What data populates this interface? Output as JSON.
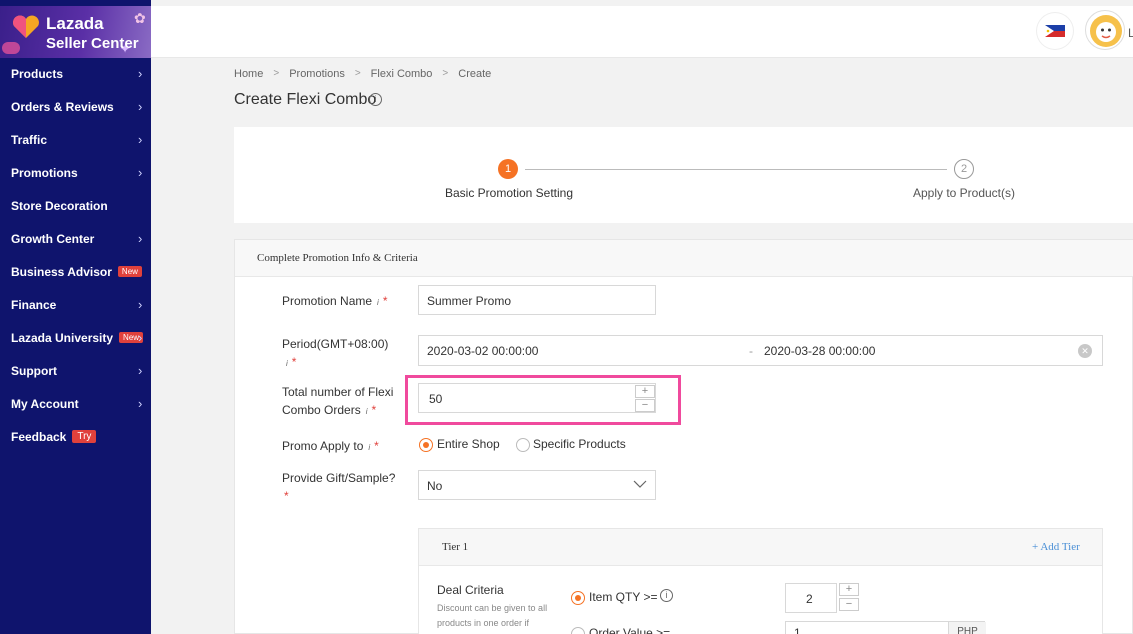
{
  "brand": {
    "name": "Lazada",
    "sub": "Seller Center"
  },
  "sidebar": {
    "items": [
      {
        "label": "Products",
        "chevron": true
      },
      {
        "label": "Orders & Reviews",
        "chevron": true
      },
      {
        "label": "Traffic",
        "chevron": true
      },
      {
        "label": "Promotions",
        "chevron": true
      },
      {
        "label": "Store Decoration",
        "chevron": false
      },
      {
        "label": "Growth Center",
        "chevron": true
      },
      {
        "label": "Business Advisor",
        "chevron": false,
        "badge": "New"
      },
      {
        "label": "Finance",
        "chevron": true
      },
      {
        "label": "Lazada University",
        "chevron": true,
        "badge": "New"
      },
      {
        "label": "Support",
        "chevron": true
      },
      {
        "label": "My Account",
        "chevron": true
      },
      {
        "label": "Feedback",
        "chevron": false,
        "badge": "Try"
      }
    ]
  },
  "header": {
    "user_initial": "L"
  },
  "breadcrumb": [
    "Home",
    "Promotions",
    "Flexi Combo",
    "Create"
  ],
  "page_title": "Create Flexi Combo",
  "steps": [
    {
      "number": "1",
      "label": "Basic Promotion Setting",
      "active": true
    },
    {
      "number": "2",
      "label": "Apply to Product(s)",
      "active": false
    }
  ],
  "form": {
    "section_title": "Complete Promotion Info & Criteria",
    "promotion_name": {
      "label": "Promotion Name",
      "value": "Summer Promo"
    },
    "period": {
      "label": "Period(GMT+08:00)",
      "start": "2020-03-02 00:00:00",
      "separator": "-",
      "end": "2020-03-28 00:00:00"
    },
    "total_orders": {
      "label_line1": "Total number of Flexi",
      "label_line2": "Combo Orders",
      "value": "50"
    },
    "promo_apply_to": {
      "label": "Promo Apply to",
      "options": [
        "Entire Shop",
        "Specific Products"
      ],
      "selected": "Entire Shop"
    },
    "gift": {
      "label": "Provide Gift/Sample?",
      "value": "No"
    },
    "tier": {
      "title": "Tier 1",
      "add_label": "+ Add Tier",
      "deal_label": "Deal Criteria",
      "deal_help": "Discount can be given to all products in one order if",
      "qty_label": "Item QTY >=",
      "qty_value": "2",
      "order_value_label": "Order Value >=",
      "order_value": "1",
      "currency": "PHP"
    }
  },
  "colors": {
    "sidebar": "#0f146d",
    "accent": "#f57224",
    "highlight": "#f04a9d",
    "required": "#e0413c"
  }
}
